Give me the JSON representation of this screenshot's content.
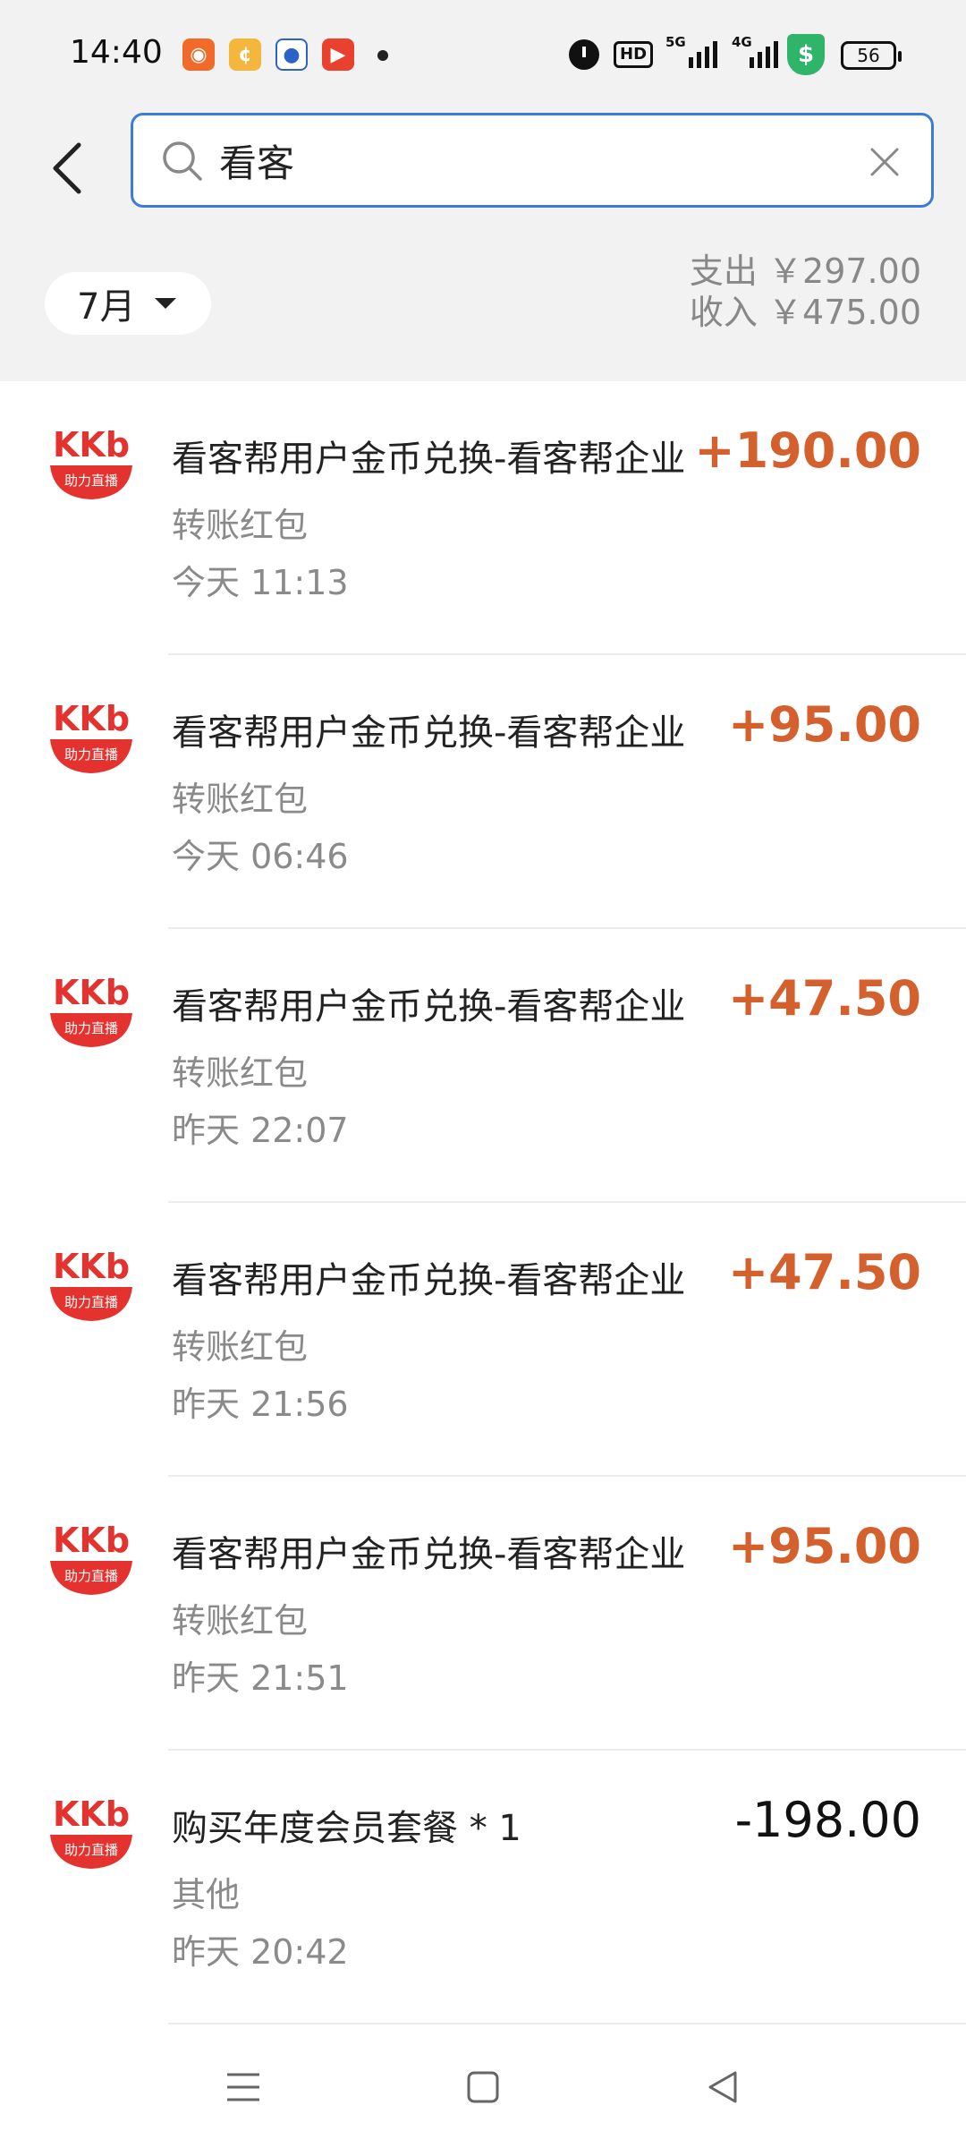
{
  "status_bar": {
    "time": "14:40",
    "hd_label": "HD",
    "net_5g": "5G",
    "net_4g": "4G",
    "battery": "56",
    "icons": [
      "kuaishou-icon",
      "coin-app-icon",
      "bank-app-icon",
      "video-app-icon",
      "alarm-icon",
      "hd-icon",
      "signal-icon",
      "shield-icon",
      "battery-icon"
    ]
  },
  "search": {
    "query": "看客",
    "placeholder": ""
  },
  "filter": {
    "month": "7月"
  },
  "summary": {
    "expense_label": "支出",
    "expense_value": "￥297.00",
    "income_label": "收入",
    "income_value": "￥475.00"
  },
  "logo": {
    "brand": "KKb",
    "tagline": "助力直播"
  },
  "transactions": [
    {
      "title": "看客帮用户金币兑换-看客帮企业",
      "category": "转账红包",
      "time": "今天 11:13",
      "amount": "+190.00"
    },
    {
      "title": "看客帮用户金币兑换-看客帮企业",
      "category": "转账红包",
      "time": "今天 06:46",
      "amount": "+95.00"
    },
    {
      "title": "看客帮用户金币兑换-看客帮企业",
      "category": "转账红包",
      "time": "昨天 22:07",
      "amount": "+47.50"
    },
    {
      "title": "看客帮用户金币兑换-看客帮企业",
      "category": "转账红包",
      "time": "昨天 21:56",
      "amount": "+47.50"
    },
    {
      "title": "看客帮用户金币兑换-看客帮企业",
      "category": "转账红包",
      "time": "昨天 21:51",
      "amount": "+95.00"
    },
    {
      "title": "购买年度会员套餐 * 1",
      "category": "其他",
      "time": "昨天 20:42",
      "amount": "-198.00"
    }
  ],
  "colors": {
    "income": "#d4602e",
    "expense": "#111111",
    "accent": "#3a7dd8",
    "logo_red": "#e4332f"
  }
}
